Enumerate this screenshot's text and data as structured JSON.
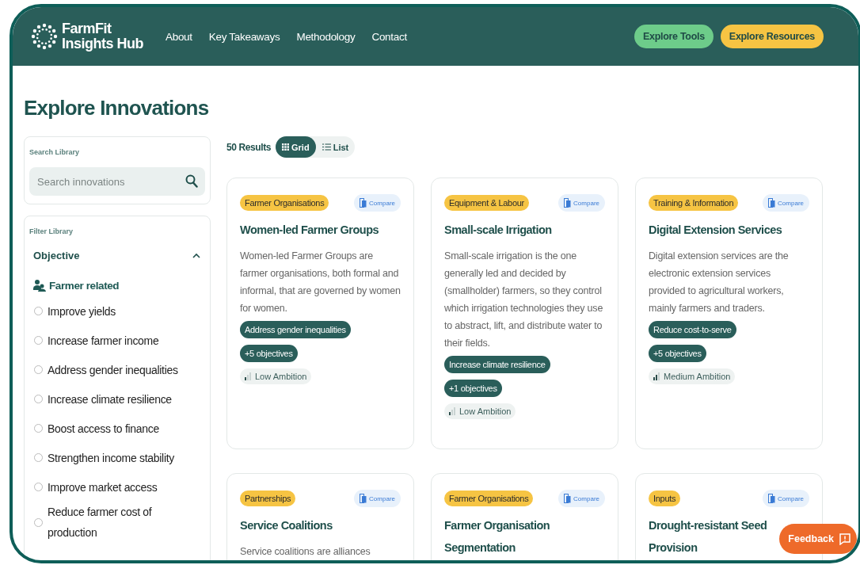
{
  "header": {
    "logo": [
      "FarmFit",
      "Insights Hub"
    ],
    "nav": [
      "About",
      "Key Takeaways",
      "Methodology",
      "Contact"
    ],
    "actions": [
      {
        "label": "Explore Tools",
        "kind": "green"
      },
      {
        "label": "Explore Resources",
        "kind": "yellow"
      }
    ]
  },
  "page_title": "Explore Innovations",
  "sidebar": {
    "search": {
      "label": "Search Library",
      "placeholder": "Search innovations"
    },
    "filter": {
      "label": "Filter Library",
      "section": {
        "title": "Objective",
        "expanded": true,
        "group": "Farmer related",
        "options": [
          {
            "label": "Improve yields",
            "checked": false
          },
          {
            "label": "Increase farmer income",
            "checked": false
          },
          {
            "label": "Address gender inequalities",
            "checked": false
          },
          {
            "label": "Increase climate resilience",
            "checked": false
          },
          {
            "label": "Boost access to finance",
            "checked": false
          },
          {
            "label": "Strengthen income stability",
            "checked": false
          },
          {
            "label": "Improve market access",
            "checked": false
          },
          {
            "label": "Reduce farmer cost of production",
            "checked": false
          }
        ]
      }
    }
  },
  "results": {
    "count": "50 Results",
    "views": [
      {
        "label": "Grid",
        "kind": "grid",
        "selected": true
      },
      {
        "label": "List",
        "kind": "list",
        "selected": false
      }
    ]
  },
  "cards": [
    {
      "category": "Farmer Organisations",
      "compare": "Compare",
      "title": "Women-led Farmer Groups",
      "description": "Women-led Farmer Groups are farmer organisations, both formal and informal, that are governed by women for women.",
      "objective": "Address gender inequalities",
      "more": "+5 objectives",
      "ambition": {
        "label": "Low Ambition",
        "level": 0.33
      }
    },
    {
      "category": "Equipment & Labour",
      "compare": "Compare",
      "title": "Small-scale Irrigation",
      "description": "Small-scale irrigation is the one generally led and decided by (smallholder) farmers, so they control which irrigation technologies they use to abstract, lift, and distribute water to their fields.",
      "objective": "Increase climate resilience",
      "more": "+1 objectives",
      "ambition": {
        "label": "Low Ambition",
        "level": 0.33
      }
    },
    {
      "category": "Training & Information",
      "compare": "Compare",
      "title": "Digital Extension Services",
      "description": "Digital extension services are the electronic extension services provided to agricultural workers, mainly farmers and traders.",
      "objective": "Reduce cost-to-serve",
      "more": "+5 objectives",
      "ambition": {
        "label": "Medium Ambition",
        "level": 0.67
      }
    },
    {
      "category": "Partnerships",
      "compare": "Compare",
      "title": "Service Coalitions",
      "description": "Service coalitions are alliances"
    },
    {
      "category": "Farmer Organisations",
      "compare": "Compare",
      "title": "Farmer Organisation Segmentation"
    },
    {
      "category": "Inputs",
      "compare": "Compare",
      "title": "Drought-resistant Seed Provision"
    }
  ],
  "feedback": "Feedback"
}
